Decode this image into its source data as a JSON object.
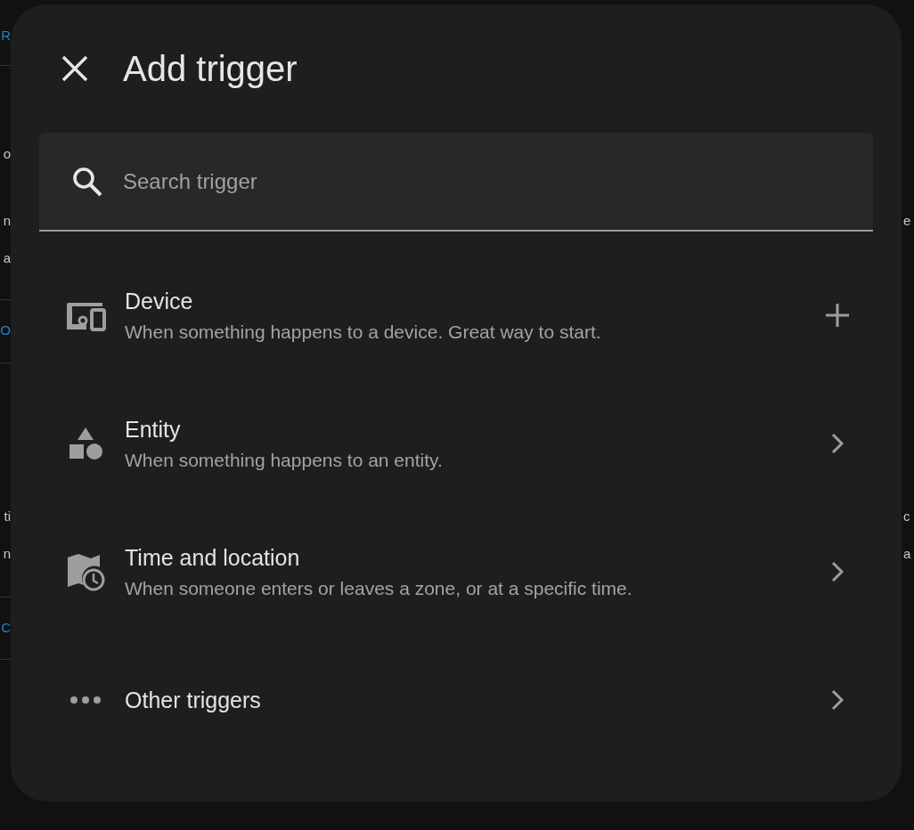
{
  "background": {
    "left": [
      {
        "text": "R",
        "kind": "link"
      },
      {
        "text": "o",
        "kind": "text"
      },
      {
        "text": "n",
        "kind": "text"
      },
      {
        "text": "a",
        "kind": "text"
      },
      {
        "text": "O",
        "kind": "link"
      },
      {
        "text": "ti",
        "kind": "text"
      },
      {
        "text": "n",
        "kind": "text"
      },
      {
        "text": "C",
        "kind": "link"
      }
    ],
    "right": [
      {
        "text": "e"
      },
      {
        "text": "c"
      },
      {
        "text": "a"
      }
    ]
  },
  "dialog": {
    "title": "Add trigger",
    "search": {
      "placeholder": "Search trigger"
    },
    "items": [
      {
        "title": "Device",
        "description": "When something happens to a device. Great way to start.",
        "kind": "add"
      },
      {
        "title": "Entity",
        "description": "When something happens to an entity.",
        "kind": "navigate"
      },
      {
        "title": "Time and location",
        "description": "When someone enters or leaves a zone, or at a specific time.",
        "kind": "navigate"
      },
      {
        "title": "Other triggers",
        "kind": "navigate"
      }
    ]
  }
}
